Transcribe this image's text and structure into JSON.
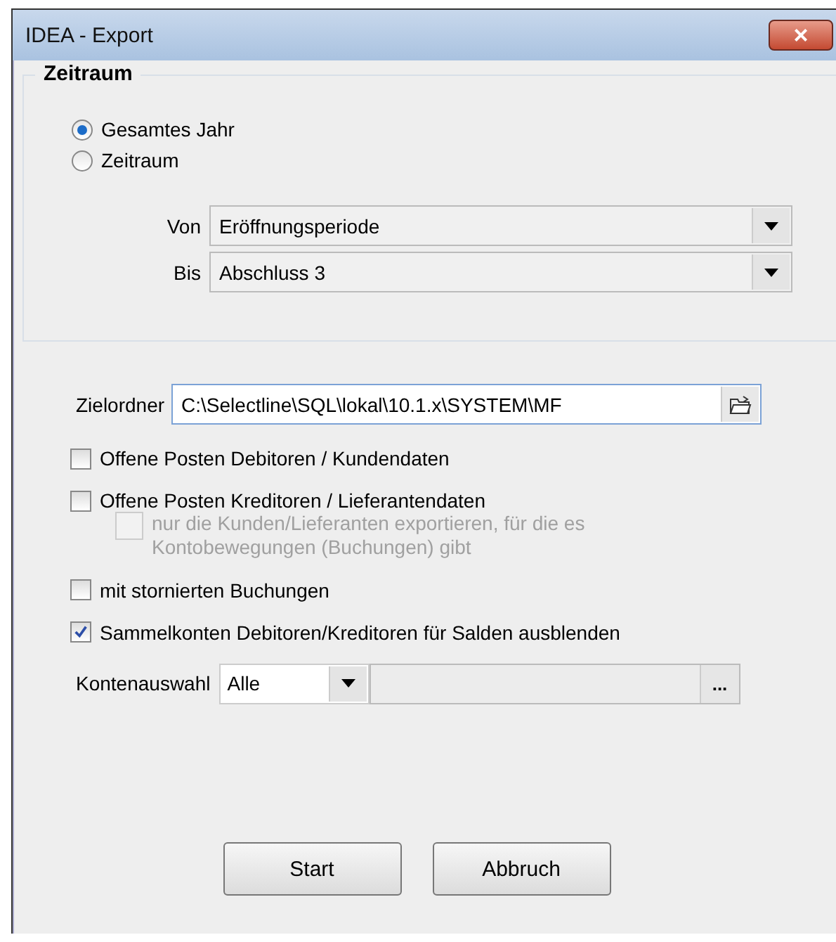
{
  "window": {
    "title": "IDEA - Export",
    "close": "×"
  },
  "period_group": {
    "title": "Zeitraum",
    "radios": [
      {
        "label": "Gesamtes Jahr",
        "selected": true
      },
      {
        "label": "Zeitraum",
        "selected": false
      }
    ],
    "from": {
      "label": "Von",
      "value": "Eröffnungsperiode"
    },
    "to": {
      "label": "Bis",
      "value": "Abschluss 3"
    }
  },
  "target_folder": {
    "label": "Zielordner",
    "value": "C:\\Selectline\\SQL\\lokal\\10.1.x\\SYSTEM\\MF"
  },
  "options": [
    {
      "label": "Offene Posten Debitoren / Kundendaten",
      "checked": false,
      "disabled": false
    },
    {
      "label": "Offene Posten Kreditoren / Lieferantendaten",
      "checked": false,
      "disabled": false,
      "children": [
        {
          "label": "nur die Kunden/Lieferanten exportieren, für die es Kontobewegungen (Buchungen) gibt",
          "checked": false,
          "disabled": true
        }
      ]
    },
    {
      "label": "mit stornierten Buchungen",
      "checked": false,
      "disabled": false
    },
    {
      "label": "Sammelkonten Debitoren/Kreditoren für Salden ausblenden",
      "checked": true,
      "disabled": false
    }
  ],
  "account_selection": {
    "label": "Kontenauswahl",
    "value": "Alle",
    "browse": "..."
  },
  "buttons": [
    "Start",
    "Abbruch"
  ]
}
